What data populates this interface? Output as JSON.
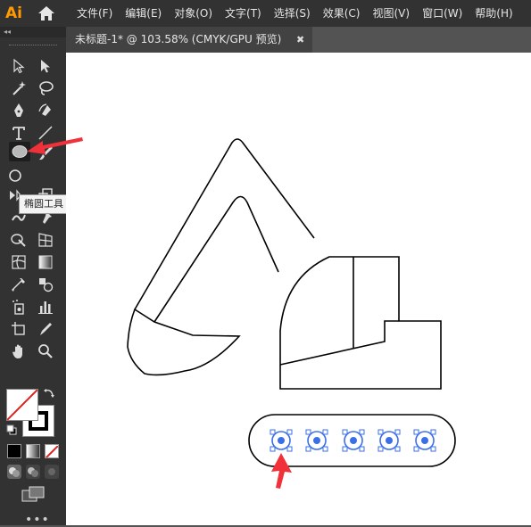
{
  "app": {
    "logo": "Ai",
    "menus": [
      "文件(F)",
      "编辑(E)",
      "对象(O)",
      "文字(T)",
      "选择(S)",
      "效果(C)",
      "视图(V)",
      "窗口(W)",
      "帮助(H)"
    ]
  },
  "document": {
    "tab_title": "未标题-1* @ 103.58% (CMYK/GPU 预览)",
    "close_glyph": "✖"
  },
  "toolbar": {
    "collapse_glyph": "◂◂",
    "tooltip": "椭圆工具 (L)",
    "selected_tool": "ellipse-tool",
    "more_glyph": "•••"
  },
  "colors": {
    "accent_arrow": "#f0313a",
    "selection_blue": "#3b6ee8",
    "panel_bg": "#323232",
    "workspace_bg": "#535353",
    "ai_logo": "#ff9a00"
  },
  "icons": {
    "home": "home-icon",
    "selection": "selection-arrow-icon",
    "direct_selection": "direct-selection-arrow-icon",
    "magic_wand": "magic-wand-icon",
    "lasso": "lasso-icon",
    "pen": "pen-icon",
    "curvature": "curvature-pen-icon",
    "type": "type-icon",
    "line": "line-segment-icon",
    "ellipse": "ellipse-icon",
    "paintbrush": "paintbrush-icon",
    "shaper": "shaper-icon",
    "eraser": "eraser-icon",
    "rotate": "rotate-icon",
    "scale": "scale-icon",
    "warp": "warp-icon",
    "puppet": "puppet-warp-icon",
    "shape_builder": "shape-builder-icon",
    "perspective": "perspective-grid-icon",
    "mesh": "mesh-icon",
    "gradient": "gradient-icon",
    "eyedropper": "eyedropper-icon",
    "blend": "blend-icon",
    "symbol_sprayer": "symbol-sprayer-icon",
    "graph": "column-graph-icon",
    "artboard": "artboard-icon",
    "slice": "slice-icon",
    "hand": "hand-icon",
    "zoom": "zoom-icon"
  }
}
